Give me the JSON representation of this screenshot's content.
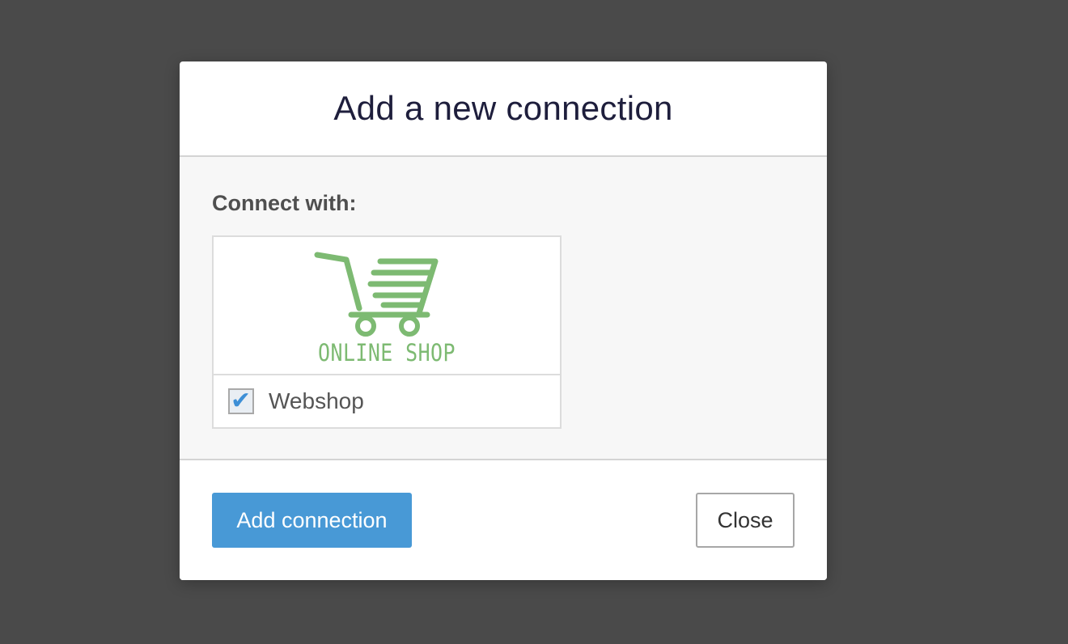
{
  "dialog": {
    "title": "Add a new connection",
    "connect_label": "Connect with:"
  },
  "options": [
    {
      "logo_icon": "shopping-cart-icon",
      "logo_text": "ONLINE SHOP",
      "logo_color": "#7dba72",
      "name": "Webshop",
      "checked": true
    }
  ],
  "footer": {
    "primary_label": "Add connection",
    "secondary_label": "Close"
  },
  "colors": {
    "accent": "#4899d6",
    "backdrop": "#4a4a4a",
    "logo_green": "#7dba72"
  }
}
